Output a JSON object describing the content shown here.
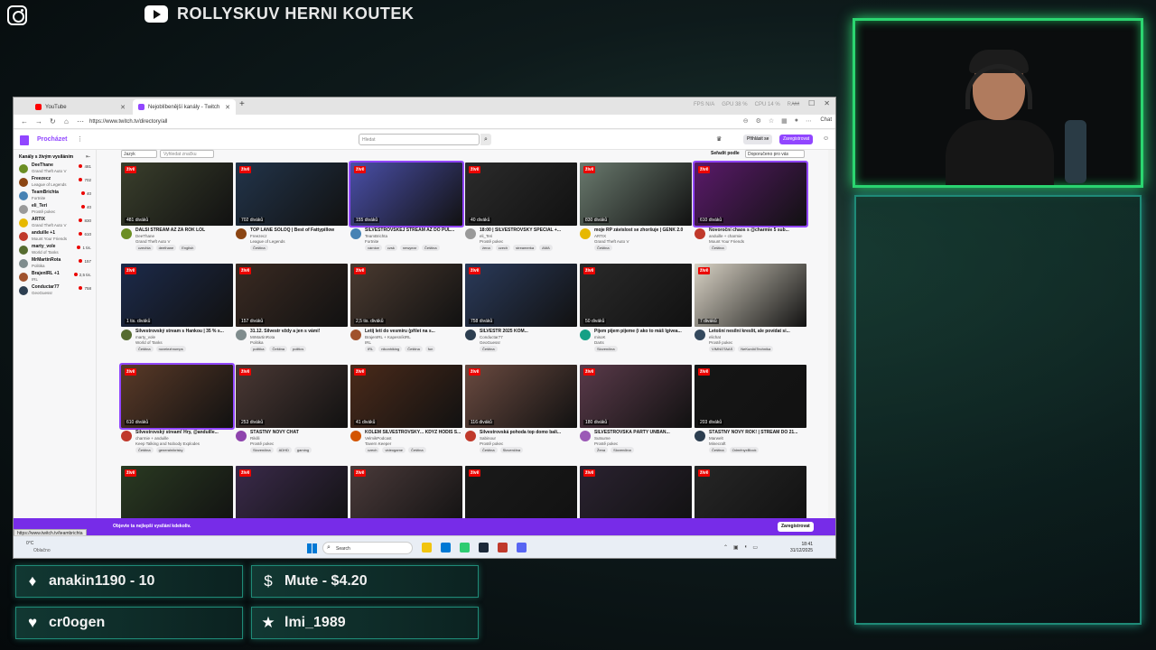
{
  "overlay": {
    "channel_name": "ROLLYSKUV HERNI KOUTEK",
    "alerts": [
      {
        "icon": "trophy-icon",
        "glyph": "♦",
        "text": "anakin1190 - 10"
      },
      {
        "icon": "dollar-icon",
        "glyph": "$",
        "text": "Mute - $4.20"
      },
      {
        "icon": "heart-icon",
        "glyph": "♥",
        "text": "cr0ogen"
      },
      {
        "icon": "star-icon",
        "glyph": "★",
        "text": "lmi_1989"
      }
    ]
  },
  "browser": {
    "tabs": [
      {
        "label": "YouTube",
        "color": "#ff0000"
      },
      {
        "label": "Nejoblíbenější kanály - Twitch",
        "color": "#9146ff"
      }
    ],
    "url": "https://www.twitch.tv/directory/all",
    "hud": {
      "fps": "FPS N/A",
      "gpu": "GPU 38 %",
      "cpu": "CPU 14 %",
      "ram": "RAM"
    },
    "chat_label": "Chat"
  },
  "twitch": {
    "browse_label": "Procházet",
    "search_placeholder": "Hledat",
    "login_label": "Přihlásit se",
    "signup_label": "Zaregistrovat",
    "sidebar_title": "Kanály s živým vysíláním",
    "filter_lang": "Jazyk",
    "filter_tag_placeholder": "Vyhledat značku",
    "sort_label": "Seřadit podle",
    "sort_value": "Doporučeno pro vás",
    "sidebar": [
      {
        "name": "DeeThane",
        "game": "Grand Theft Auto V",
        "viewers": "481",
        "color": "#6b8e23"
      },
      {
        "name": "Freezecz",
        "game": "League of Legends",
        "viewers": "702",
        "color": "#8b4513"
      },
      {
        "name": "TeamBrichta",
        "game": "Fortnite",
        "viewers": "40",
        "color": "#4682b4"
      },
      {
        "name": "eli_Teri",
        "game": "Prostě pokec",
        "viewers": "40",
        "color": "#999999",
        "extra": "Hype Train • úroveň 4"
      },
      {
        "name": "ARTIX",
        "game": "Grand Theft Auto V",
        "viewers": "830",
        "color": "#e6b800"
      },
      {
        "name": "anduille +1",
        "game": "Mount Your Friends",
        "viewers": "610",
        "color": "#c0392b"
      },
      {
        "name": "marty_vole",
        "game": "World of Tanks",
        "viewers": "1 tis.",
        "color": "#556b2f"
      },
      {
        "name": "MrMartinRota",
        "game": "Politika",
        "viewers": "157",
        "color": "#7f8c8d"
      },
      {
        "name": "BrajenIRL +1",
        "game": "IRL",
        "viewers": "2,5 tis.",
        "color": "#a0522d"
      },
      {
        "name": "Conductar77",
        "game": "GeoGuessr",
        "viewers": "758",
        "color": "#2c3e50"
      }
    ],
    "cards": [
      {
        "title": "DALŠÍ STREAM AŽ ZA ROK LOL",
        "channel": "DeeThane",
        "game": "Grand Theft Auto V",
        "viewers": "481 diváků",
        "tags": [
          "czechia",
          "deethane",
          "English"
        ],
        "thumb": "#3a3f2c",
        "av": "#6b8e23",
        "hl": false
      },
      {
        "title": "TOP LANE SOLOQ | Best of Fattypillow",
        "channel": "Freezecz",
        "game": "League of Legends",
        "viewers": "702 diváků",
        "tags": [
          "Čeština"
        ],
        "thumb": "#22344a",
        "av": "#8b4513",
        "hl": false
      },
      {
        "title": "SILVESTROVSKEJ STREAM AŽ DO PŮL...",
        "channel": "TeamBrichta",
        "game": "Fortnite",
        "viewers": "155 diváků",
        "tags": [
          "várnice",
          "czsk",
          "newyear",
          "Čeština"
        ],
        "thumb": "#4a4fa8",
        "av": "#4682b4",
        "hl": true
      },
      {
        "title": "18:00 | SILVESTROVSKÝ SPECIÁL +...",
        "channel": "eli_Teri",
        "game": "Prostě pokec",
        "viewers": "40 diváků",
        "tags": [
          "žena",
          "czech",
          "streamerka",
          "AMA"
        ],
        "thumb": "#2b2b2b",
        "av": "#999999",
        "hl": false
      },
      {
        "title": "moje RP závislost se zhoršuje | GENK 2.0",
        "channel": "ARTIX",
        "game": "Grand Theft Auto V",
        "viewers": "830 diváků",
        "tags": [
          "Čeština"
        ],
        "thumb": "#6a7a6e",
        "av": "#e6b800",
        "hl": false
      },
      {
        "title": "Novoroční chaos s @charmie 5 sub...",
        "channel": "anduille + charmie",
        "game": "Mount Your Friends",
        "viewers": "610 diváků",
        "tags": [
          "Čeština"
        ],
        "thumb": "#5a1a6a",
        "av": "#c0392b",
        "hl": true
      },
      {
        "title": "Silvestrovský stream s Hankou | 35 % s...",
        "channel": "marty_vole",
        "game": "World of Tanks",
        "viewers": "1 tis. diváků",
        "tags": [
          "Čeština",
          "novelezhrumps"
        ],
        "thumb": "#1c2a4a",
        "av": "#556b2f",
        "hl": false
      },
      {
        "title": "31.12. Silvestr vždy a jen s vámi!",
        "channel": "MrMartinRota",
        "game": "Politika",
        "viewers": "157 diváků",
        "tags": [
          "politika",
          "Čeština",
          "politics"
        ],
        "thumb": "#3a2a22",
        "av": "#7f8c8d",
        "hl": false
      },
      {
        "title": "Letíj letí do vesmíru (přilet na s...",
        "channel": "BrajenIRL + KapesníkIRL",
        "game": "IRL",
        "viewers": "2,5 tis. diváků",
        "tags": [
          "IRL",
          "nikonhiking",
          "Čeština",
          "fun"
        ],
        "thumb": "#4a3a30",
        "av": "#a0522d",
        "hl": false
      },
      {
        "title": "SILVESTR 2025 KOM...",
        "channel": "Conductar77",
        "game": "GeoGuessr",
        "viewers": "758 diváků",
        "tags": [
          "Čeština"
        ],
        "thumb": "#2a3a5a",
        "av": "#2c3e50",
        "hl": false
      },
      {
        "title": "Pijem pijem pijeme (i ako to máš lgivea...",
        "channel": "misoK",
        "game": "Darts",
        "viewers": "50 diváků",
        "tags": [
          "Slovenčina"
        ],
        "thumb": "#2a2a2a",
        "av": "#16a085",
        "hl": false
      },
      {
        "title": "Letošní nesílní kreslit, ale povídat si...",
        "channel": "elichat",
        "game": "Prostě pokec",
        "viewers": "7 diváků",
        "tags": [
          "VIMNOTAAS",
          "NeKunčičTechnika"
        ],
        "thumb": "#d8d2c4",
        "av": "#34495e",
        "hl": false
      },
      {
        "title": "Silvestrovský stream! Hry, @anduille...",
        "channel": "charmie + anduille",
        "game": "Keep Talking and Nobody Explodes",
        "viewers": "610 diváků",
        "tags": [
          "Čeština",
          "generalníkrisky"
        ],
        "thumb": "#5a3a28",
        "av": "#c0392b",
        "hl": true
      },
      {
        "title": "ŠŤASTNÝ NOVÝ CHAT",
        "channel": "Rikilli",
        "game": "Prostě pokec",
        "viewers": "253 diváků",
        "tags": [
          "Slovenčina",
          "ADHD",
          "gaming"
        ],
        "thumb": "#4a3834",
        "av": "#8e44ad",
        "hl": false
      },
      {
        "title": "KOLEM SILVESTROVSKÝ... KDYŽ HODÍŠ S...",
        "channel": "VelmikPodcast",
        "game": "Tavern Keeper",
        "viewers": "41 diváků",
        "tags": [
          "czech",
          "videogame",
          "Čeština"
        ],
        "thumb": "#4a2a1a",
        "av": "#d35400",
        "hl": false
      },
      {
        "title": "Silvestrovská pohoda top domo bali...",
        "channel": "Sabinour",
        "game": "Prostě pokec",
        "viewers": "116 diváků",
        "tags": [
          "Čeština",
          "Slovenčina"
        ],
        "thumb": "#6a4a40",
        "av": "#c0392b",
        "hl": false
      },
      {
        "title": "SILVESTROVSKÁ PÁRTY UNBAN...",
        "channel": "Sutsume",
        "game": "Prostě pokec",
        "viewers": "180 diváků",
        "tags": [
          "Žena",
          "Slovenčina"
        ],
        "thumb": "#5a3a4a",
        "av": "#9b59b6",
        "hl": false
      },
      {
        "title": "ŠŤASTNÝ NOVÝ ROK! | STREAM DO 21...",
        "channel": "Marwelt",
        "game": "Minecraft",
        "viewers": "203 diváků",
        "tags": [
          "Čeština",
          "OdměnyxBlock"
        ],
        "thumb": "#161616",
        "av": "#2c3e50",
        "hl": false
      },
      {
        "title": "",
        "channel": "",
        "game": "",
        "viewers": "",
        "tags": [],
        "thumb": "#2a3a22",
        "av": "#333333",
        "hl": false
      },
      {
        "title": "",
        "channel": "",
        "game": "",
        "viewers": "",
        "tags": [],
        "thumb": "#3a2a4a",
        "av": "#333333",
        "hl": false
      },
      {
        "title": "",
        "channel": "",
        "game": "",
        "viewers": "",
        "tags": [],
        "thumb": "#4a3a3a",
        "av": "#333333",
        "hl": false
      },
      {
        "title": "",
        "channel": "",
        "game": "",
        "viewers": "",
        "tags": [],
        "thumb": "#1a1a1a",
        "av": "#333333",
        "hl": false
      },
      {
        "title": "",
        "channel": "",
        "game": "",
        "viewers": "",
        "tags": [],
        "thumb": "#2a2230",
        "av": "#333333",
        "hl": false
      },
      {
        "title": "",
        "channel": "",
        "game": "",
        "viewers": "",
        "tags": [],
        "thumb": "#262626",
        "av": "#333333",
        "hl": false
      }
    ],
    "banner_text": "Objevte ta nejlepší vysílání kdekoliv.",
    "banner_button": "Zaregistrovat",
    "status_url": "https://www.twitch.tv/teambrichta"
  },
  "taskbar": {
    "weather_temp": "0°C",
    "weather_desc": "Oblačno",
    "search_label": "Search",
    "time": "18:41",
    "date": "31/12/2025",
    "apps": [
      "#f1c40f",
      "#0078d4",
      "#2ecc71",
      "#1b2838",
      "#c0392b",
      "#5865f2"
    ]
  }
}
